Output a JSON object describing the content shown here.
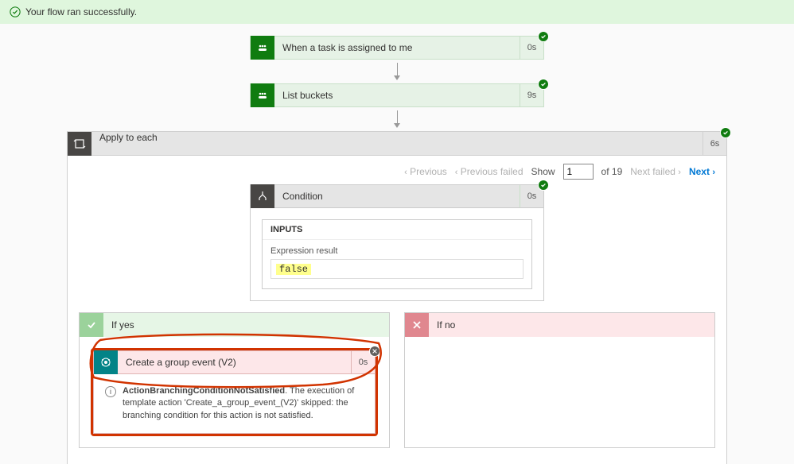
{
  "banner": {
    "message": "Your flow ran successfully."
  },
  "steps": {
    "trigger": {
      "title": "When a task is assigned to me",
      "duration": "0s"
    },
    "listBuckets": {
      "title": "List buckets",
      "duration": "9s"
    },
    "foreach": {
      "title": "Apply to each",
      "duration": "6s"
    },
    "condition": {
      "title": "Condition",
      "duration": "0s"
    },
    "groupEvent": {
      "title": "Create a group event (V2)",
      "duration": "0s"
    }
  },
  "pager": {
    "previous": "Previous",
    "previousFailed": "Previous failed",
    "showLabel": "Show",
    "current": "1",
    "ofLabel": "of 19",
    "nextFailed": "Next failed",
    "next": "Next"
  },
  "conditionCard": {
    "inputsLabel": "INPUTS",
    "expressionLabel": "Expression result",
    "expressionValue": "false"
  },
  "branches": {
    "yes": "If yes",
    "no": "If no"
  },
  "error": {
    "title": "ActionBranchingConditionNotSatisfied",
    "text": ". The execution of template action 'Create_a_group_event_(V2)' skipped: the branching condition for this action is not satisfied."
  }
}
